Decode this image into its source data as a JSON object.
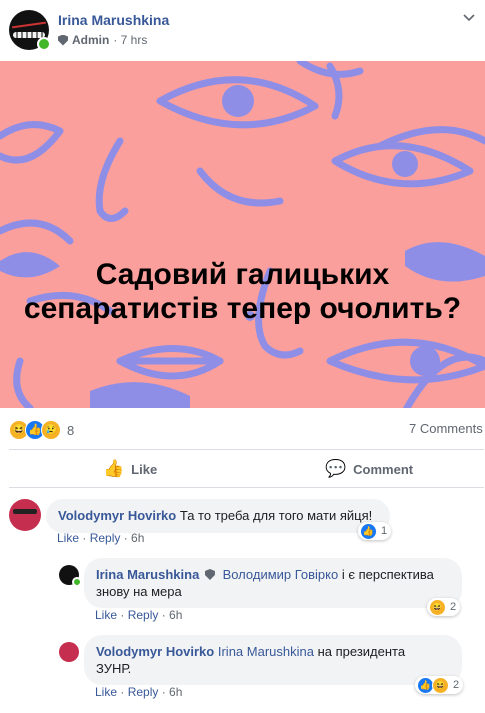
{
  "post": {
    "author": "Irina Marushkina",
    "role": "Admin",
    "time": "· 7 hrs",
    "banner_line1": "Садовий галицьких",
    "banner_line2": "сепаратистів тепер очолить?",
    "reaction_count": "8",
    "comments_count": "7 Comments",
    "like_label": "Like",
    "comment_label": "Comment"
  },
  "comments": [
    {
      "author": "Volodymyr Hovirko",
      "text": "Та то треба для того мати яйця!",
      "like": "Like",
      "reply": "Reply",
      "time": "6h",
      "reaction_count": "1"
    },
    {
      "author": "Irina Marushkina",
      "mention": "Володимир Говірко",
      "text_line1": "і є перспектива",
      "text_line2": "знову на мера",
      "like": "Like",
      "reply": "Reply",
      "time": "6h",
      "reaction_count": "2"
    },
    {
      "author": "Volodymyr Hovirko",
      "mention": "Irina Marushkina",
      "text_line1": "на президента",
      "text_line2": "ЗУНР.",
      "like": "Like",
      "reply": "Reply",
      "time": "6h",
      "reaction_count": "2"
    }
  ],
  "colors": {
    "banner_bg": "#fb9f9c",
    "banner_art": "#8f8ee6",
    "link": "#385898",
    "online": "#42b72a"
  },
  "icons": [
    "chevron-down-icon",
    "shield-icon",
    "haha-icon",
    "like-icon",
    "sad-icon",
    "thumbs-up-icon",
    "speech-bubble-icon"
  ]
}
